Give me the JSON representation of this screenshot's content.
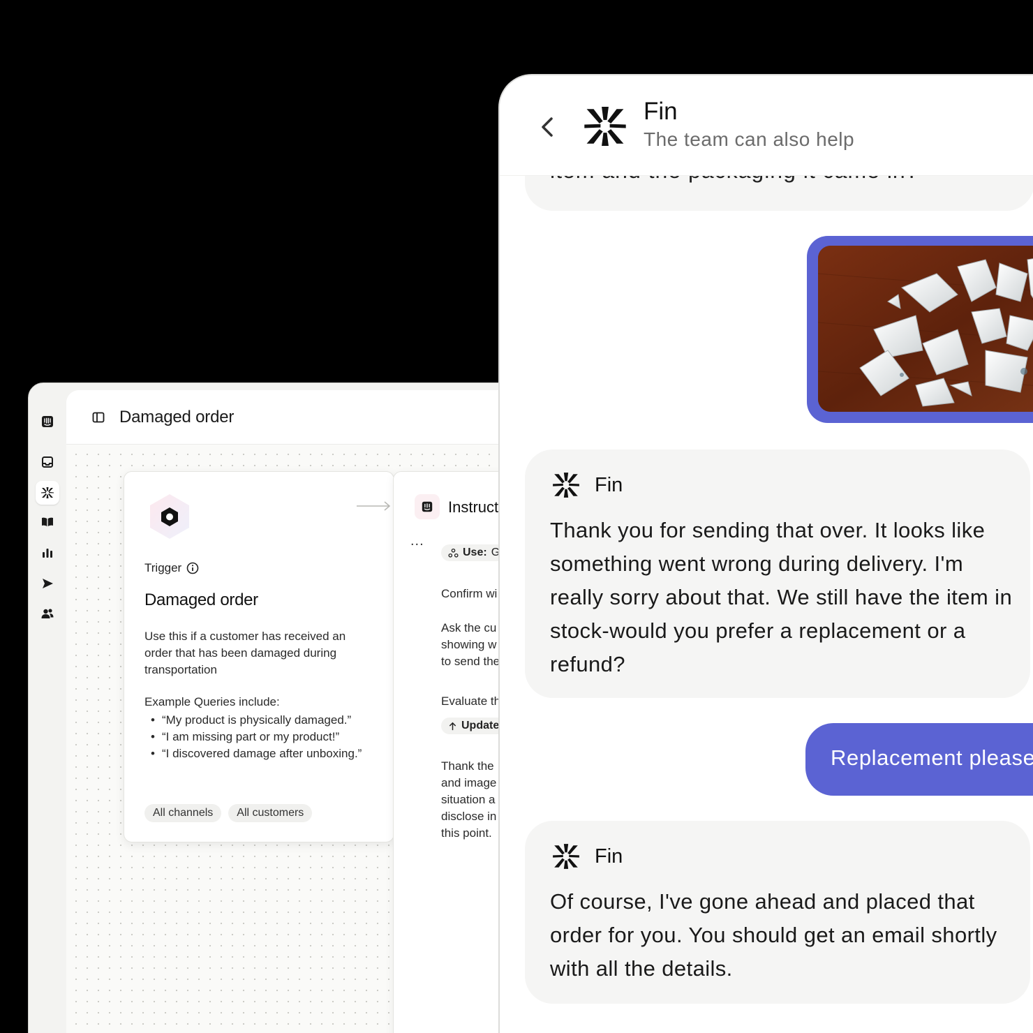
{
  "editor": {
    "title": "Damaged order",
    "rail_icons": [
      "intercom-logo-icon",
      "inbox-icon",
      "fin-icon",
      "book-icon",
      "bar-chart-icon",
      "send-icon",
      "users-icon"
    ],
    "trigger_card": {
      "label": "Trigger",
      "title": "Damaged order",
      "description": "Use this if a customer has received an order that has been damaged during transportation",
      "examples_heading": "Example Queries include:",
      "examples": [
        "“My product is physically damaged.”",
        "“I am missing part or my product!”",
        "“I discovered damage after unboxing.”"
      ],
      "chips": [
        "All channels",
        "All customers"
      ]
    },
    "instruction_card": {
      "title": "Instructions",
      "more": "...",
      "use_label": "Use:",
      "use_value": "Ge",
      "step1": "Confirm wi",
      "step2": "Ask the cu showing w to send the",
      "step3": "Evaluate th",
      "update_label": "Update",
      "step4": "Thank the and image situation a disclose in this point."
    }
  },
  "chat": {
    "header": {
      "name": "Fin",
      "subtitle": "The team can also help"
    },
    "previous_message_tail": "item and the packaging it came in?",
    "messages": [
      {
        "sender": "Fin",
        "text": "Thank you for sending that over. It looks like something went wrong during delivery. I'm really sorry about that. We still have the item in stock-would you prefer a replacement or a refund?"
      },
      {
        "sender": "user",
        "text": "Replacement please"
      },
      {
        "sender": "Fin",
        "text": "Of course, I've gone ahead and placed that order for you. You should get an email shortly with all the details."
      }
    ],
    "colors": {
      "user_bubble": "#5b63d3",
      "fin_bubble": "#f5f5f4"
    }
  }
}
